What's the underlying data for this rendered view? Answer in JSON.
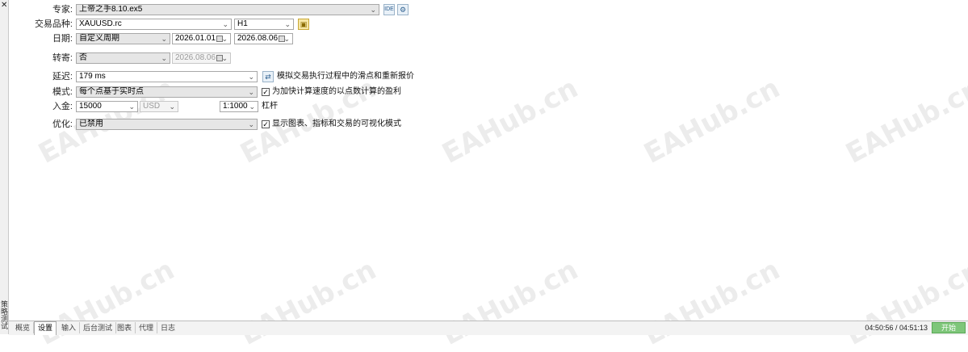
{
  "side": {
    "close": "✕",
    "title": "策略测试"
  },
  "labels": {
    "expert": "专家:",
    "symbol": "交易品种:",
    "date": "日期:",
    "forward": "转寄:",
    "delay": "延迟:",
    "model": "模式:",
    "deposit": "入金:",
    "optimization": "优化:"
  },
  "fields": {
    "expert": "上帝之手8.10.ex5",
    "ide": "IDE",
    "symbol": "XAUUSD.rc",
    "timeframe": "H1",
    "date_range": "自定义周期",
    "date_from": "2026.01.01",
    "date_to": "2026.08.06",
    "forward": "否",
    "forward_date": "2026.08.06",
    "delay": "179 ms",
    "model": "每个点基于实时点",
    "deposit": "15000",
    "currency": "USD",
    "leverage": "1:1000",
    "optimization": "已禁用"
  },
  "checks": {
    "random_delay": "模拟交易执行过程中的滑点和重新报价",
    "profit_pips": "为加快计算速度的以点数计算的盈利",
    "visual": "显示图表、指标和交易的可视化模式",
    "leverage_label": "杠杆"
  },
  "tabs": [
    "概览",
    "设置",
    "输入",
    "后台测试",
    "图表",
    "代理",
    "日志"
  ],
  "active_tab": "设置",
  "timer": "04:50:56 / 04:51:13",
  "start": "开始",
  "watermark": "EAHub.cn",
  "colors": {
    "start_bg": "#7ec67a"
  }
}
